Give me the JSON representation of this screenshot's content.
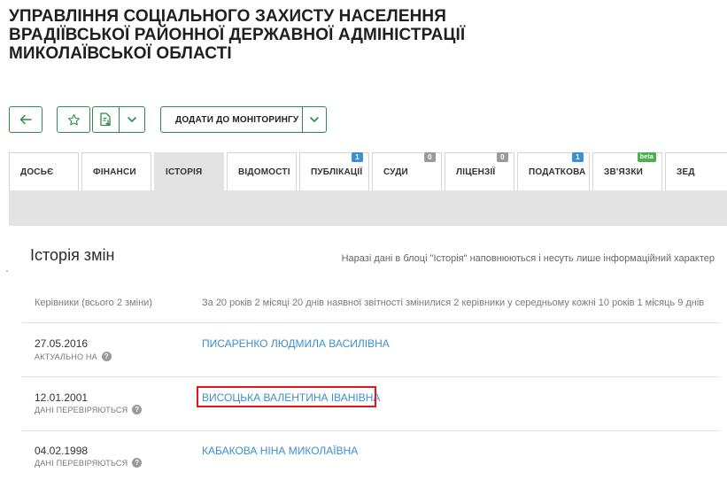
{
  "org": {
    "title_lines": [
      "УПРАВЛІННЯ СОЦІАЛЬНОГО ЗАХИСТУ НАСЕЛЕННЯ",
      "ВРАДІЇВСЬКОЇ РАЙОННОЇ ДЕРЖАВНОЇ АДМІНІСТРАЦІЇ",
      "МИКОЛАЇВСЬКОЇ ОБЛАСТІ"
    ]
  },
  "toolbar": {
    "monitor_label": "ДОДАТИ ДО МОНІТОРИНГУ"
  },
  "tabs": [
    {
      "label": "ДОСЬЄ",
      "badge": ""
    },
    {
      "label": "ФІНАНСИ",
      "badge": ""
    },
    {
      "label": "ІСТОРІЯ",
      "badge": ""
    },
    {
      "label": "ВІДОМОСТІ",
      "badge": ""
    },
    {
      "label": "ПУБЛІКАЦІЇ",
      "badge": "1"
    },
    {
      "label": "СУДИ",
      "badge": "0"
    },
    {
      "label": "ЛІЦЕНЗІЇ",
      "badge": "0"
    },
    {
      "label": "ПОДАТКОВА",
      "badge": "1"
    },
    {
      "label": "ЗВ'ЯЗКИ",
      "badge": "beta"
    },
    {
      "label": "ЗЕД",
      "badge": ""
    }
  ],
  "colors": {
    "accent": "#2e8b4a",
    "badge_blue": "#3c8fd1",
    "badge_gray": "#9a9a9a",
    "badge_green": "#4caf50",
    "link": "#3c8fd1",
    "highlight": "#e2161b"
  },
  "history": {
    "title": "Історія змін",
    "note": "Наразі дані в блоці \"Історія\" наповнюються і несуть лише інформаційний характер",
    "summary_label": "Керівники (всього 2 зміни)",
    "summary_text": "За 20 років 2 місяці 20 днів наявної звітності змінилися 2 керівники у середньому кожні 10 років 1 місяць 9 днів",
    "rows": [
      {
        "date": "27.05.2016",
        "status": "АКТУАЛЬНО НА",
        "name": "ПИСАРЕНКО ЛЮДМИЛА ВАСИЛІВНА"
      },
      {
        "date": "12.01.2001",
        "status": "ДАНІ ПЕРЕВІРЯЮТЬСЯ",
        "name": "ВИСОЦЬКА ВАЛЕНТИНА ІВАНІВНА"
      },
      {
        "date": "04.02.1998",
        "status": "ДАНІ ПЕРЕВІРЯЮТЬСЯ",
        "name": "КАБАКОВА НІНА МИКОЛАЇВНА"
      }
    ],
    "help_glyph": "?"
  }
}
